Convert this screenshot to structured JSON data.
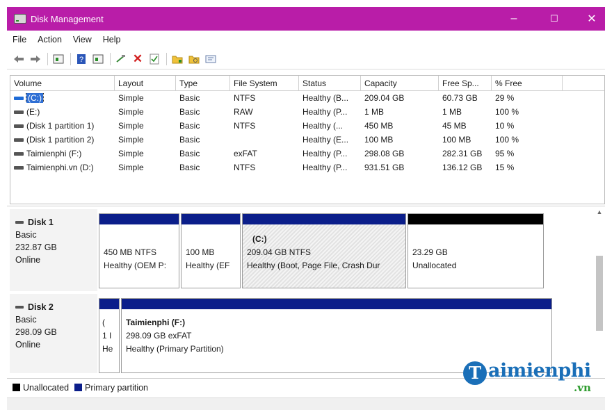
{
  "window": {
    "title": "Disk Management",
    "controls": {
      "minimize": "–",
      "maximize": "☐",
      "close": "✕"
    }
  },
  "menu": [
    "File",
    "Action",
    "View",
    "Help"
  ],
  "toolbar": [
    "back-arrow-icon",
    "forward-arrow-icon",
    "list-view-icon",
    "help-icon",
    "properties-icon",
    "connect-icon",
    "delete-icon",
    "check-icon",
    "folder-icon",
    "search-folder-icon",
    "console-icon"
  ],
  "volume_table": {
    "columns": [
      "Volume",
      "Layout",
      "Type",
      "File System",
      "Status",
      "Capacity",
      "Free Sp...",
      "% Free"
    ],
    "rows": [
      [
        "(C:)",
        "Simple",
        "Basic",
        "NTFS",
        "Healthy (B...",
        "209.04 GB",
        "60.73 GB",
        "29 %"
      ],
      [
        "(E:)",
        "Simple",
        "Basic",
        "RAW",
        "Healthy (P...",
        "1 MB",
        "1 MB",
        "100 %"
      ],
      [
        "(Disk 1 partition 1)",
        "Simple",
        "Basic",
        "NTFS",
        "Healthy (...",
        "450 MB",
        "45 MB",
        "10 %"
      ],
      [
        "(Disk 1 partition 2)",
        "Simple",
        "Basic",
        "",
        "Healthy (E...",
        "100 MB",
        "100 MB",
        "100 %"
      ],
      [
        "Taimienphi (F:)",
        "Simple",
        "Basic",
        "exFAT",
        "Healthy (P...",
        "298.08 GB",
        "282.31 GB",
        "95 %"
      ],
      [
        "Taimienphi.vn (D:)",
        "Simple",
        "Basic",
        "NTFS",
        "Healthy (P...",
        "931.51 GB",
        "136.12 GB",
        "15 %"
      ]
    ]
  },
  "disks": [
    {
      "name": "Disk 1",
      "type": "Basic",
      "size": "232.87 GB",
      "state": "Online",
      "partitions": [
        {
          "title": "",
          "line1": "450 MB NTFS",
          "line2": "Healthy (OEM P:"
        },
        {
          "title": "",
          "line1": "100 MB",
          "line2": "Healthy (EF"
        },
        {
          "title": "(C:)",
          "line1": "209.04 GB NTFS",
          "line2": "Healthy (Boot, Page File, Crash Dur"
        },
        {
          "title": "",
          "line1": "23.29 GB",
          "line2": "Unallocated"
        }
      ]
    },
    {
      "name": "Disk 2",
      "type": "Basic",
      "size": "298.09 GB",
      "state": "Online",
      "partitions": [
        {
          "title": "(",
          "line1": "1 I",
          "line2": "He"
        },
        {
          "title": "Taimienphi  (F:)",
          "line1": "298.09 GB exFAT",
          "line2": "Healthy (Primary Partition)"
        }
      ]
    }
  ],
  "legend": [
    {
      "label": "Unallocated",
      "color": "#000000"
    },
    {
      "label": "Primary partition",
      "color": "#0b1e8a"
    }
  ],
  "watermark": {
    "mark": "T",
    "name": "aimienphi",
    "suffix": ".vn"
  },
  "colors": {
    "titlebar": "#b91da8",
    "primary": "#0b1e8a",
    "unallocated": "#000000",
    "selection": "#2f6fd4"
  }
}
